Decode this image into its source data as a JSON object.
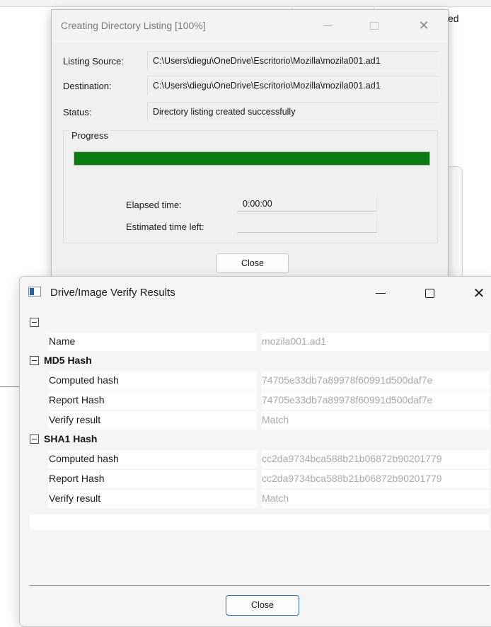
{
  "background": {
    "corner_text": "ed"
  },
  "listing_dialog": {
    "title": "Creating Directory Listing [100%]",
    "fields": [
      {
        "label": "Listing Source:",
        "value": "C:\\Users\\diegu\\OneDrive\\Escritorio\\Mozilla\\mozila001.ad1"
      },
      {
        "label": "Destination:",
        "value": "C:\\Users\\diegu\\OneDrive\\Escritorio\\Mozilla\\mozila001.ad1"
      },
      {
        "label": "Status:",
        "value": "Directory listing created successfully"
      }
    ],
    "progress": {
      "group_label": "Progress",
      "percent": 100,
      "elapsed_label": "Elapsed time:",
      "elapsed_value": "0:00:00",
      "remaining_label": "Estimated time left:",
      "remaining_value": ""
    },
    "close_label": "Close",
    "progress_color": "#0a7a12"
  },
  "verify_dialog": {
    "title": "Drive/Image Verify Results",
    "name_row": {
      "label": "Name",
      "value": "mozila001.ad1"
    },
    "md5": {
      "title": "MD5 Hash",
      "rows": [
        {
          "label": "Computed hash",
          "value": "74705e33db7a89978f60991d500daf7e"
        },
        {
          "label": "Report Hash",
          "value": "74705e33db7a89978f60991d500daf7e"
        },
        {
          "label": "Verify result",
          "value": "Match"
        }
      ]
    },
    "sha1": {
      "title": "SHA1 Hash",
      "rows": [
        {
          "label": "Computed hash",
          "value": "cc2da9734bca588b21b06872b90201779"
        },
        {
          "label": "Report Hash",
          "value": "cc2da9734bca588b21b06872b90201779"
        },
        {
          "label": "Verify result",
          "value": "Match"
        }
      ]
    },
    "close_label": "Close",
    "accent_color": "#2a6fbd"
  }
}
